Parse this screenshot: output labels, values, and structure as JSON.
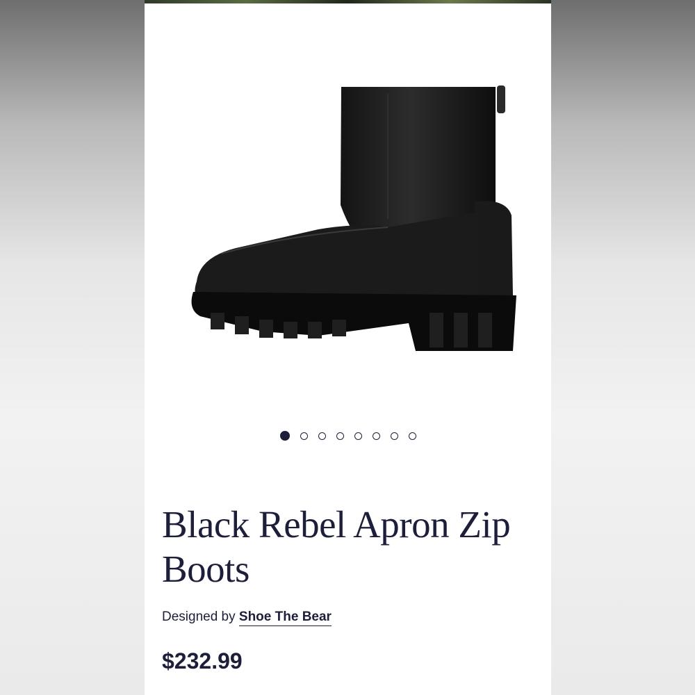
{
  "product": {
    "title": "Black Rebel Apron Zip Boots",
    "designed_by_label": "Designed by",
    "designer_name": "Shoe The Bear",
    "price": "$232.99",
    "image": "black-leather-boot"
  },
  "carousel": {
    "total_slides": 8,
    "active_slide": 1
  },
  "colors": {
    "text": "#1d1f3a",
    "background": "#ffffff"
  }
}
